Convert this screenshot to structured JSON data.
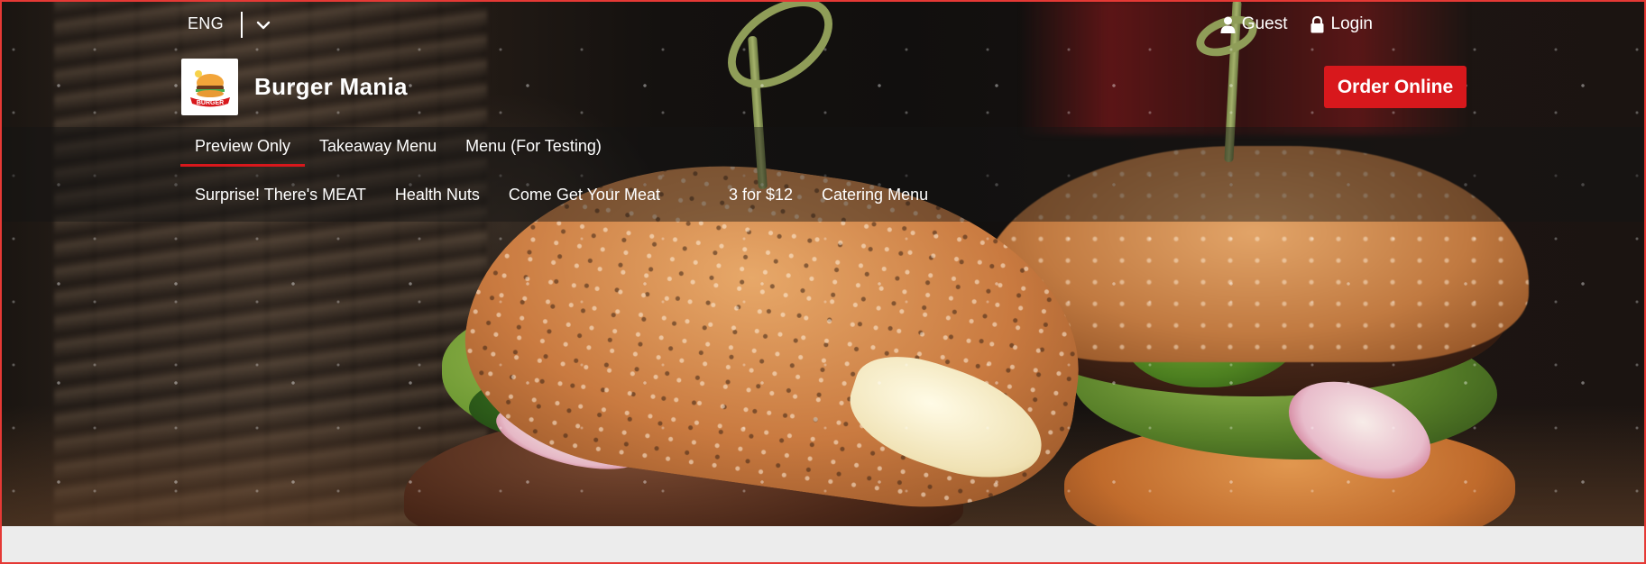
{
  "topbar": {
    "language": "ENG",
    "guest_label": "Guest",
    "login_label": "Login"
  },
  "brand": {
    "name": "Burger Mania",
    "logo_text": "BURGER"
  },
  "order_button_label": "Order Online",
  "nav": {
    "row1": [
      {
        "label": "Preview Only",
        "active": true
      },
      {
        "label": "Takeaway Menu",
        "active": false
      },
      {
        "label": "Menu (For Testing)",
        "active": false
      }
    ],
    "row2": [
      {
        "label": "Surprise! There's MEAT"
      },
      {
        "label": "Health Nuts"
      },
      {
        "label": "Come Get Your Meat"
      },
      {
        "label": "3 for $12"
      },
      {
        "label": "Catering Menu"
      }
    ]
  },
  "colors": {
    "accent": "#d8181c",
    "border": "#e53935",
    "page_background": "#ececec"
  }
}
